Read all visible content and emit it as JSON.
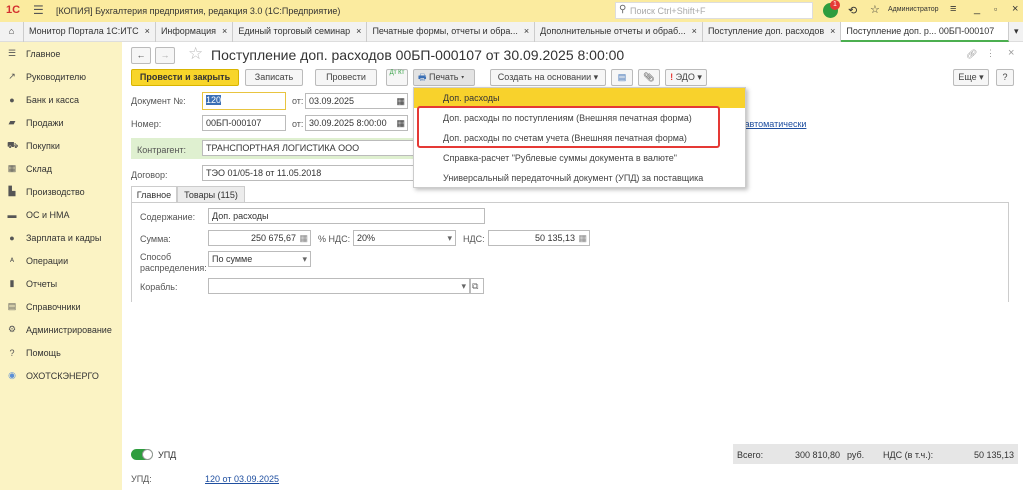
{
  "titlebar": {
    "app_title": "[КОПИЯ] Бухгалтерия предприятия, редакция 3.0  (1С:Предприятие)",
    "search_placeholder": "Поиск Ctrl+Shift+F",
    "notif_count": "1",
    "user": "Администратор"
  },
  "tabs": [
    "Монитор Портала 1С:ИТС",
    "Информация",
    "Единый торговый семинар",
    "Печатные формы, отчеты и обра...",
    "Дополнительные отчеты и обраб...",
    "Поступление доп. расходов",
    "Поступление доп. р...  00БП-000107"
  ],
  "sidebar": [
    "Главное",
    "Руководителю",
    "Банк и касса",
    "Продажи",
    "Покупки",
    "Склад",
    "Производство",
    "ОС и НМА",
    "Зарплата и кадры",
    "Операции",
    "Отчеты",
    "Справочники",
    "Администрирование",
    "Помощь",
    "ОХОТСКЭНЕРГО"
  ],
  "doc": {
    "title": "Поступление доп. расходов 00БП-000107 от 30.09.2025 8:00:00"
  },
  "toolbar": {
    "post_close": "Провести и закрыть",
    "save": "Записать",
    "post": "Провести",
    "dtkt": "Дт Кт",
    "print": "Печать",
    "create_based": "Создать на основании",
    "edo": "ЭДО",
    "more": "Еще",
    "help": "?"
  },
  "print_menu": [
    "Доп. расходы",
    "Доп. расходы по поступлениям (Внешняя печатная форма)",
    "Доп. расходы по счетам учета (Внешняя печатная форма)",
    "Справка-расчет \"Рублевые суммы документа в валюте\"",
    "Универсальный передаточный документ (УПД) за поставщика"
  ],
  "form": {
    "docnum_label": "Документ №:",
    "docnum": "120",
    "from_label": "от:",
    "docdate": "03.09.2025",
    "number_label": "Номер:",
    "number": "00БП-000107",
    "numdate": "30.09.2025  8:00:00",
    "auto_link": "а автоматически",
    "contractor_label": "Контрагент:",
    "contractor": "ТРАНСПОРТНАЯ ЛОГИСТИКА ООО",
    "contract_label": "Договор:",
    "contract": "ТЭО 01/05-18 от 11.05.2018"
  },
  "inner_tabs": [
    "Главное",
    "Товары (115)"
  ],
  "main": {
    "content_label": "Содержание:",
    "content": "Доп. расходы",
    "sum_label": "Сумма:",
    "sum": "250 675,67",
    "vat_rate_label": "% НДС:",
    "vat_rate": "20%",
    "vat_label": "НДС:",
    "vat": "50 135,13",
    "method_label1": "Способ",
    "method_label2": "распределения:",
    "method": "По сумме",
    "ship_label": "Корабль:"
  },
  "footer": {
    "upd_toggle": "УПД",
    "upd_label": "УПД:",
    "upd_link": "120 от 03.09.2025",
    "total_label": "Всего:",
    "total": "300 810,80",
    "currency": "руб.",
    "vat_incl_label": "НДС (в т.ч.):",
    "vat_total": "50 135,13"
  }
}
